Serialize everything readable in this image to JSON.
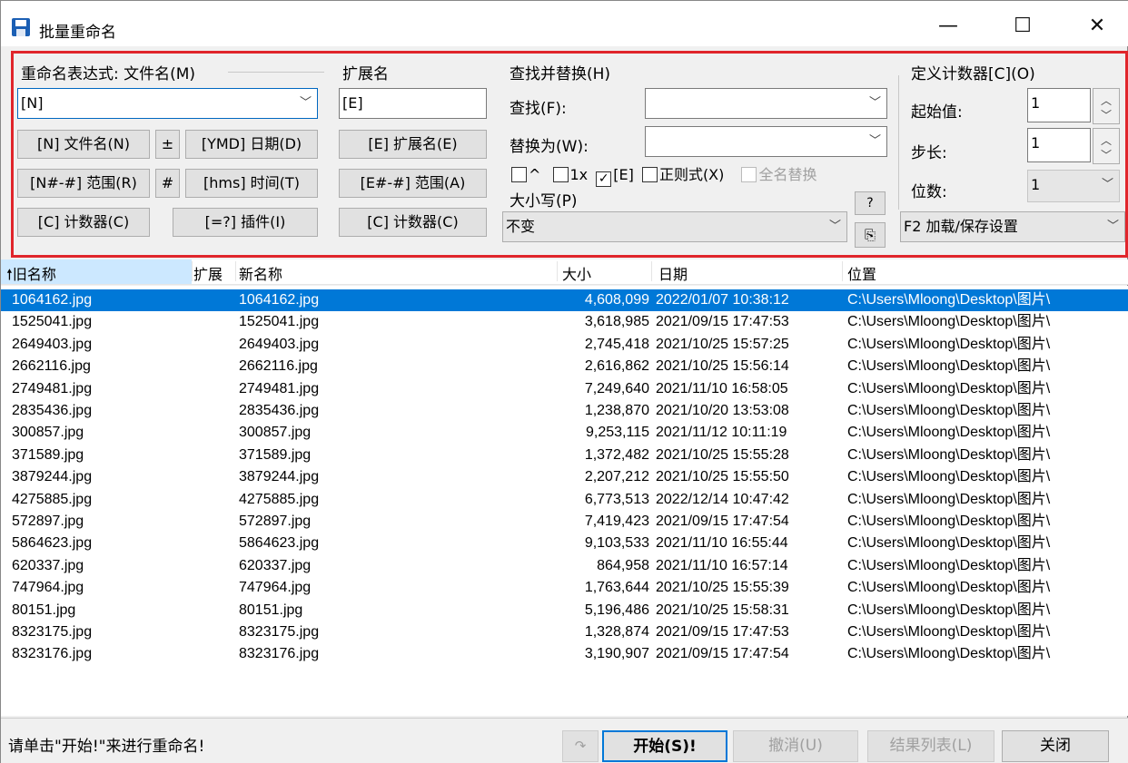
{
  "window": {
    "title": "批量重命名",
    "minimize": "—",
    "maximize": "☐",
    "close": "✕"
  },
  "groups": {
    "expr": {
      "label": "重命名表达式: 文件名(M)",
      "value": "[N]"
    },
    "ext": {
      "label": "扩展名",
      "value": "[E]"
    },
    "find": {
      "label": "查找并替换(H)",
      "find_label": "查找(F):",
      "replace_label": "替换为(W):",
      "find_value": "",
      "replace_value": ""
    },
    "counter": {
      "label": "定义计数器[C](O)",
      "start_label": "起始值:",
      "start_value": "1",
      "step_label": "步长:",
      "step_value": "1",
      "digits_label": "位数:",
      "digits_value": "1"
    }
  },
  "buttons": {
    "filename": "[N] 文件名(N)",
    "plusminus": "±",
    "ymd": "[YMD] 日期(D)",
    "range": "[N#-#] 范围(R)",
    "hash": "#",
    "hms": "[hms] 时间(T)",
    "counter": "[C] 计数器(C)",
    "plugin": "[=?] 插件(I)",
    "extname": "[E] 扩展名(E)",
    "extrange": "[E#-#] 范围(A)",
    "extcounter": "[C] 计数器(C)",
    "help": "?",
    "copy": "⎘"
  },
  "options": {
    "caret": "^",
    "once": "1x",
    "ext": "[E]",
    "regex": "正则式(X)",
    "fullname": "全名替换"
  },
  "case": {
    "label": "大小写(P)",
    "value": "不变"
  },
  "settings": {
    "label": "F2 加载/保存设置"
  },
  "columns": {
    "old": "旧名称",
    "ext": "扩展",
    "new": "新名称",
    "size": "大小",
    "date": "日期",
    "location": "位置"
  },
  "files": [
    {
      "old": "1064162.jpg",
      "new": "1064162.jpg",
      "size": "4,608,099",
      "date": "2022/01/07 10:38:12",
      "location": "C:\\Users\\Mloong\\Desktop\\图片\\"
    },
    {
      "old": "1525041.jpg",
      "new": "1525041.jpg",
      "size": "3,618,985",
      "date": "2021/09/15 17:47:53",
      "location": "C:\\Users\\Mloong\\Desktop\\图片\\"
    },
    {
      "old": "2649403.jpg",
      "new": "2649403.jpg",
      "size": "2,745,418",
      "date": "2021/10/25 15:57:25",
      "location": "C:\\Users\\Mloong\\Desktop\\图片\\"
    },
    {
      "old": "2662116.jpg",
      "new": "2662116.jpg",
      "size": "2,616,862",
      "date": "2021/10/25 15:56:14",
      "location": "C:\\Users\\Mloong\\Desktop\\图片\\"
    },
    {
      "old": "2749481.jpg",
      "new": "2749481.jpg",
      "size": "7,249,640",
      "date": "2021/11/10 16:58:05",
      "location": "C:\\Users\\Mloong\\Desktop\\图片\\"
    },
    {
      "old": "2835436.jpg",
      "new": "2835436.jpg",
      "size": "1,238,870",
      "date": "2021/10/20 13:53:08",
      "location": "C:\\Users\\Mloong\\Desktop\\图片\\"
    },
    {
      "old": "300857.jpg",
      "new": "300857.jpg",
      "size": "9,253,115",
      "date": "2021/11/12 10:11:19",
      "location": "C:\\Users\\Mloong\\Desktop\\图片\\"
    },
    {
      "old": "371589.jpg",
      "new": "371589.jpg",
      "size": "1,372,482",
      "date": "2021/10/25 15:55:28",
      "location": "C:\\Users\\Mloong\\Desktop\\图片\\"
    },
    {
      "old": "3879244.jpg",
      "new": "3879244.jpg",
      "size": "2,207,212",
      "date": "2021/10/25 15:55:50",
      "location": "C:\\Users\\Mloong\\Desktop\\图片\\"
    },
    {
      "old": "4275885.jpg",
      "new": "4275885.jpg",
      "size": "6,773,513",
      "date": "2022/12/14 10:47:42",
      "location": "C:\\Users\\Mloong\\Desktop\\图片\\"
    },
    {
      "old": "572897.jpg",
      "new": "572897.jpg",
      "size": "7,419,423",
      "date": "2021/09/15 17:47:54",
      "location": "C:\\Users\\Mloong\\Desktop\\图片\\"
    },
    {
      "old": "5864623.jpg",
      "new": "5864623.jpg",
      "size": "9,103,533",
      "date": "2021/11/10 16:55:44",
      "location": "C:\\Users\\Mloong\\Desktop\\图片\\"
    },
    {
      "old": "620337.jpg",
      "new": "620337.jpg",
      "size": "864,958",
      "date": "2021/11/10 16:57:14",
      "location": "C:\\Users\\Mloong\\Desktop\\图片\\"
    },
    {
      "old": "747964.jpg",
      "new": "747964.jpg",
      "size": "1,763,644",
      "date": "2021/10/25 15:55:39",
      "location": "C:\\Users\\Mloong\\Desktop\\图片\\"
    },
    {
      "old": "80151.jpg",
      "new": "80151.jpg",
      "size": "5,196,486",
      "date": "2021/10/25 15:58:31",
      "location": "C:\\Users\\Mloong\\Desktop\\图片\\"
    },
    {
      "old": "8323175.jpg",
      "new": "8323175.jpg",
      "size": "1,328,874",
      "date": "2021/09/15 17:47:53",
      "location": "C:\\Users\\Mloong\\Desktop\\图片\\"
    },
    {
      "old": "8323176.jpg",
      "new": "8323176.jpg",
      "size": "3,190,907",
      "date": "2021/09/15 17:47:54",
      "location": "C:\\Users\\Mloong\\Desktop\\图片\\"
    }
  ],
  "status": {
    "text": "请单击\"开始!\"来进行重命名!",
    "start": "开始(S)!",
    "undo": "撤消(U)",
    "results": "结果列表(L)",
    "close": "关闭"
  },
  "colors": {
    "highlight": "#e0252b",
    "selection": "#0078d7"
  }
}
